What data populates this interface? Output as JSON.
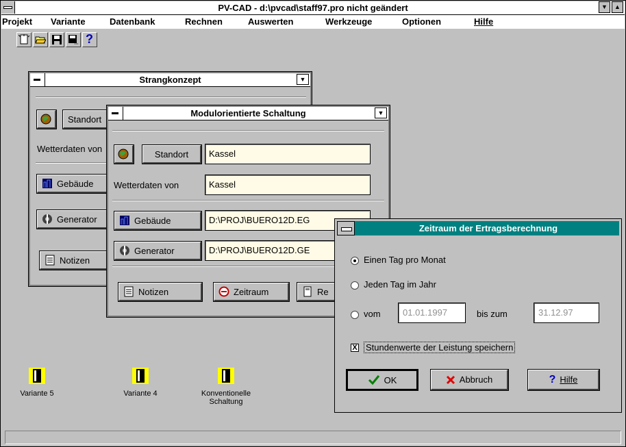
{
  "app": {
    "title": "PV-CAD - d:\\pvcad\\staff97.pro   nicht geändert",
    "menu": [
      "Projekt",
      "Variante",
      "Datenbank",
      "Rechnen",
      "Auswerten",
      "Werkzeuge",
      "Optionen",
      "Hilfe"
    ],
    "toolbar": [
      "new-icon",
      "open-icon",
      "save-icon",
      "save-as-icon",
      "help-icon"
    ],
    "toolbar_help_glyph": "?"
  },
  "strangkonzept": {
    "title": "Strangkonzept",
    "standort_label": "Standort",
    "wetter_label": "Wetterdaten von",
    "gebaeude_label": "Gebäude",
    "generator_label": "Generator",
    "notizen_label": "Notizen"
  },
  "modul": {
    "title": "Modulorientierte Schaltung",
    "standort_label": "Standort",
    "standort_value": "Kassel",
    "wetter_label": "Wetterdaten von",
    "wetter_value": "Kassel",
    "gebaeude_label": "Gebäude",
    "gebaeude_value": "D:\\PROJ\\BUERO12D.EG",
    "generator_label": "Generator",
    "generator_value": "D:\\PROJ\\BUERO12D.GE",
    "notizen_label": "Notizen",
    "zeitraum_label": "Zeitraum",
    "rechnen_label": "Re"
  },
  "dialog": {
    "title": "Zeitraum der Ertragsberechnung",
    "option1": "Einen Tag pro Monat",
    "option2": "Jeden Tag im Jahr",
    "option3": "vom",
    "from_value": "01.01.1997",
    "bis_label": "bis zum",
    "to_value": "31.12.97",
    "checkbox_label": "Stundenwerte der Leistung speichern",
    "checkbox_mark": "X",
    "ok_label": "OK",
    "cancel_label": "Abbruch",
    "help_label": "Hilfe",
    "selected_option": 1,
    "checkbox_checked": true
  },
  "desktop_icons": [
    {
      "label": "Variante 5"
    },
    {
      "label": "Variante 4"
    },
    {
      "label": "Konventionelle Schaltung"
    }
  ],
  "colors": {
    "dialog_title": "#008080",
    "field_bg": "#fffbe6"
  }
}
